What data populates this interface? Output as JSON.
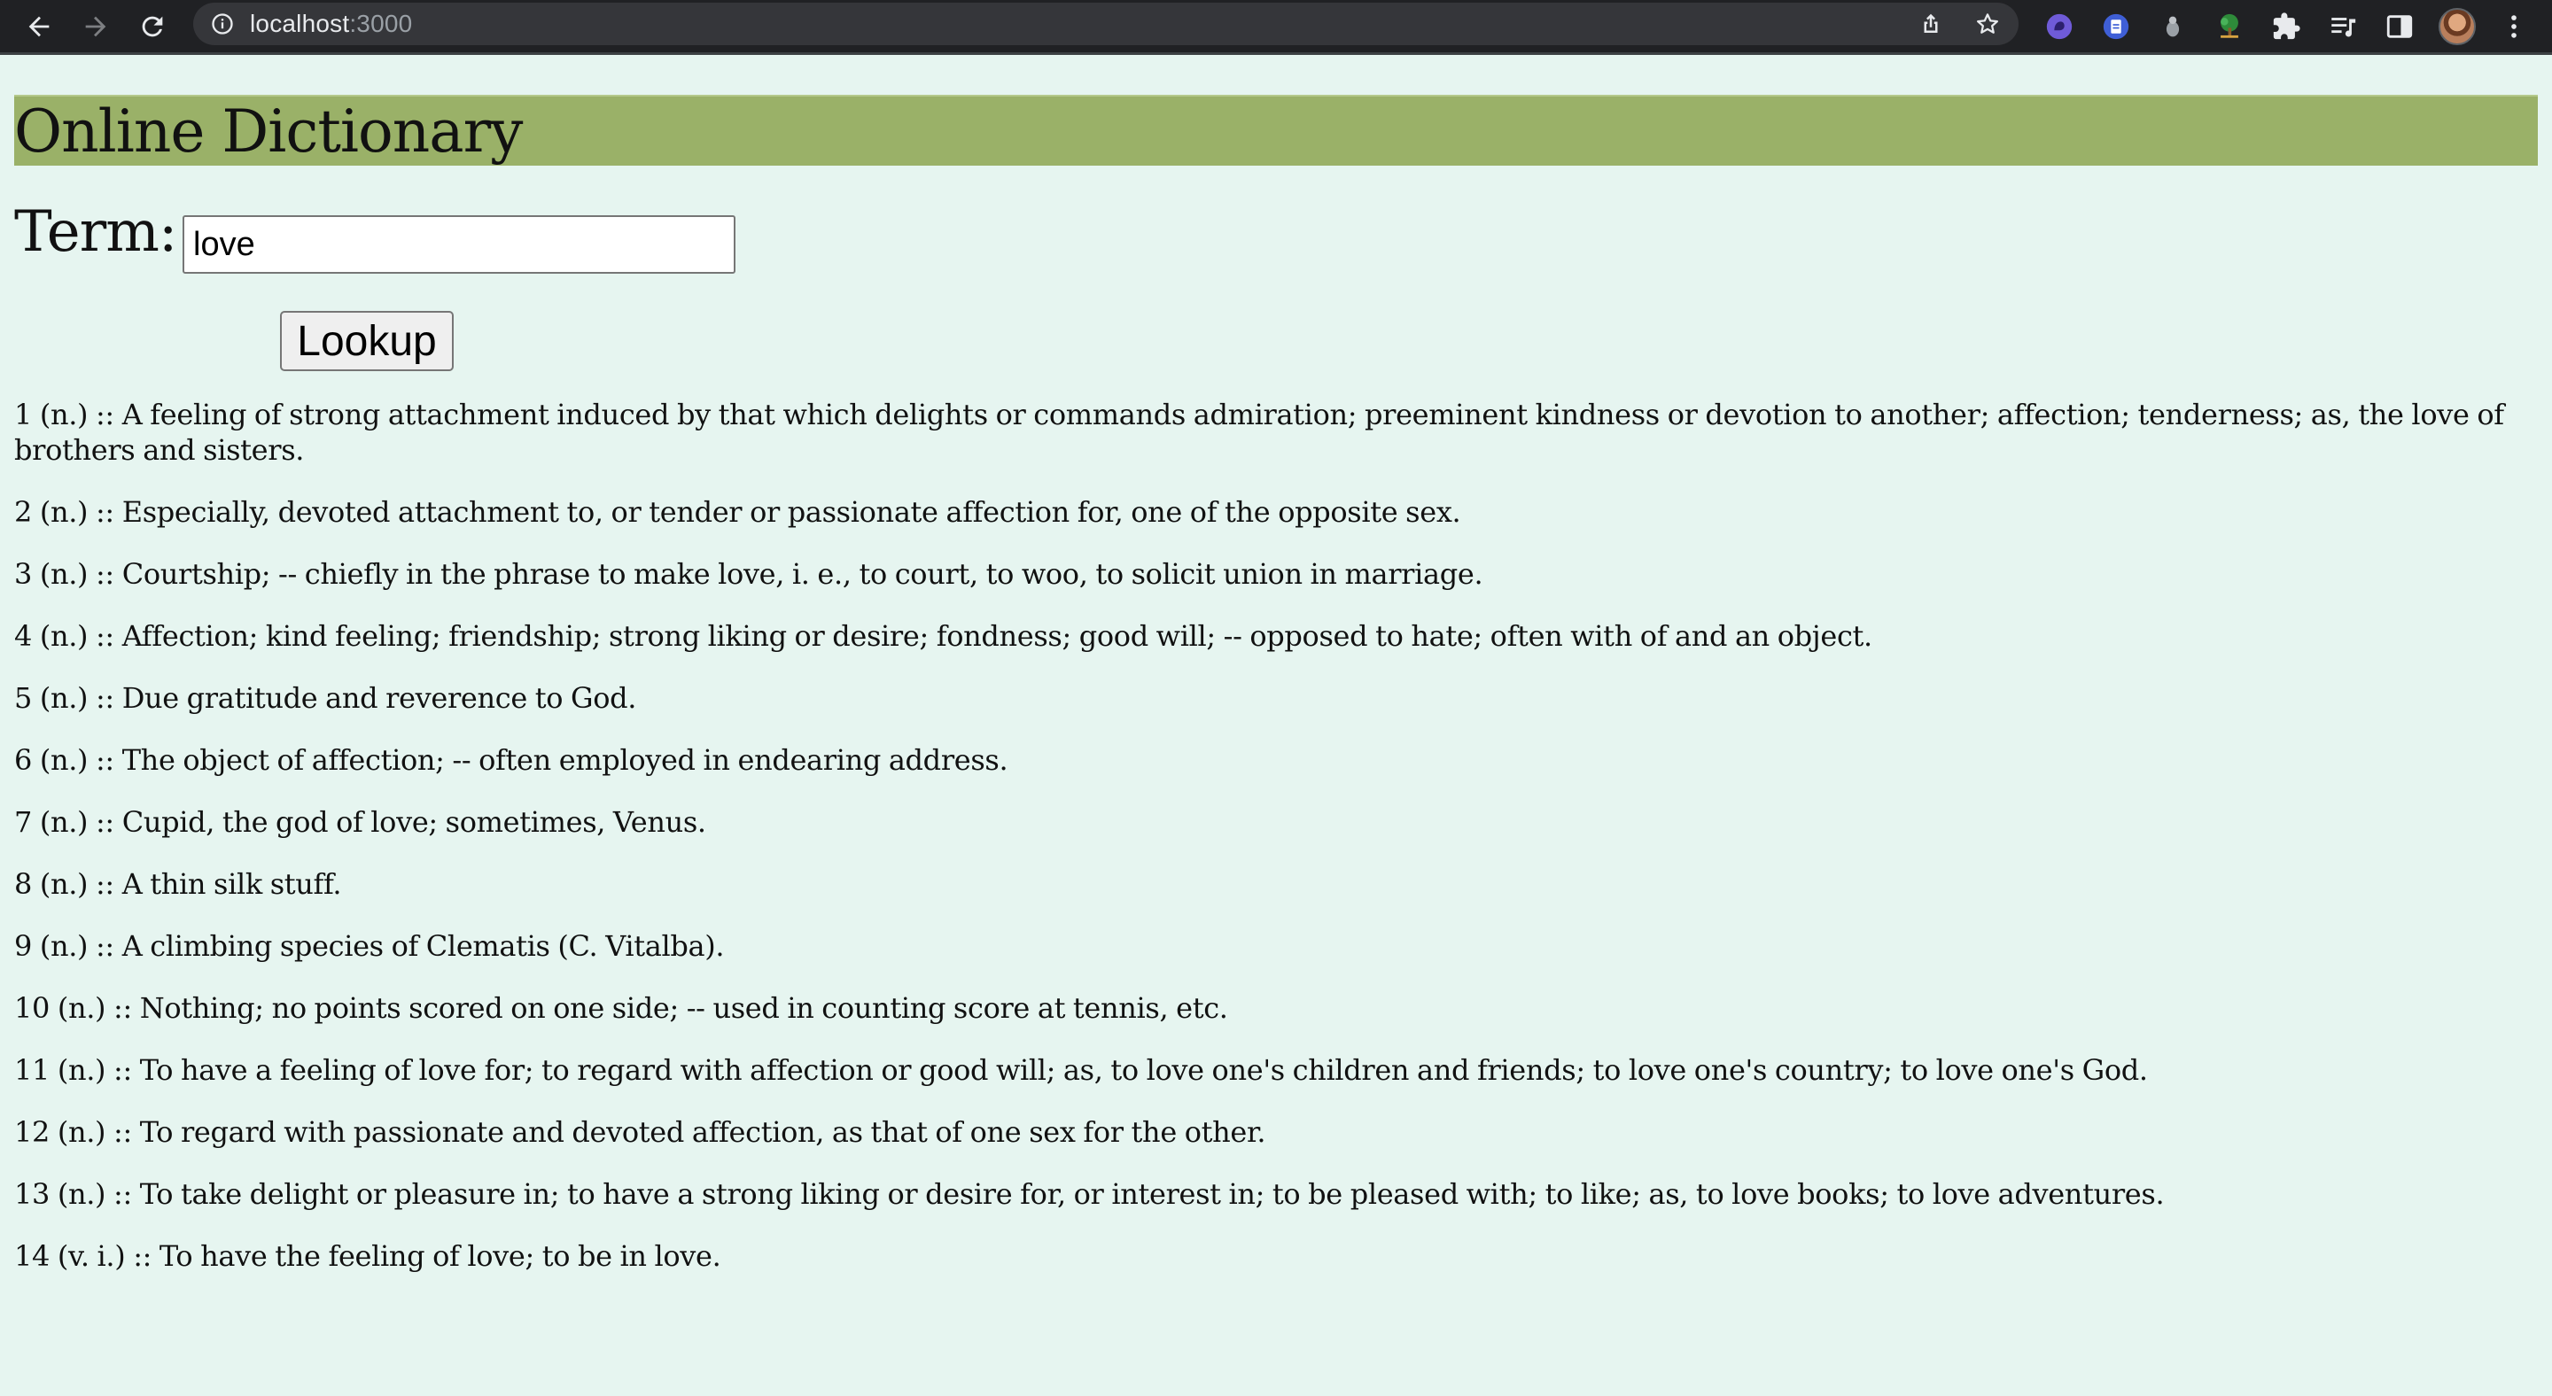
{
  "browser": {
    "url_host": "localhost",
    "url_port": ":3000",
    "icons": [
      "back-icon",
      "forward-icon",
      "reload-icon",
      "info-icon",
      "share-icon",
      "bookmark-star-icon",
      "extension-icon",
      "puzzle-icon",
      "reading-list-icon",
      "side-panel-icon",
      "menu-dots-icon"
    ]
  },
  "page": {
    "title": "Online Dictionary",
    "term_label": "Term:",
    "term_value": "love",
    "lookup_label": "Lookup",
    "colors": {
      "header_background": "#9ab168",
      "page_background": "#e6f5f0"
    }
  },
  "definitions": [
    "1 (n.) :: A feeling of strong attachment induced by that which delights or commands admiration; preeminent kindness or devotion to another; affection; tenderness; as, the love of brothers and sisters.",
    "2 (n.) :: Especially, devoted attachment to, or tender or passionate affection for, one of the opposite sex.",
    "3 (n.) :: Courtship; -- chiefly in the phrase to make love, i. e., to court, to woo, to solicit union in marriage.",
    "4 (n.) :: Affection; kind feeling; friendship; strong liking or desire; fondness; good will; -- opposed to hate; often with of and an object.",
    "5 (n.) :: Due gratitude and reverence to God.",
    "6 (n.) :: The object of affection; -- often employed in endearing address.",
    "7 (n.) :: Cupid, the god of love; sometimes, Venus.",
    "8 (n.) :: A thin silk stuff.",
    "9 (n.) :: A climbing species of Clematis (C. Vitalba).",
    "10 (n.) :: Nothing; no points scored on one side; -- used in counting score at tennis, etc.",
    "11 (n.) :: To have a feeling of love for; to regard with affection or good will; as, to love one's children and friends; to love one's country; to love one's God.",
    "12 (n.) :: To regard with passionate and devoted affection, as that of one sex for the other.",
    "13 (n.) :: To take delight or pleasure in; to have a strong liking or desire for, or interest in; to be pleased with; to like; as, to love books; to love adventures.",
    "14 (v. i.) :: To have the feeling of love; to be in love."
  ]
}
